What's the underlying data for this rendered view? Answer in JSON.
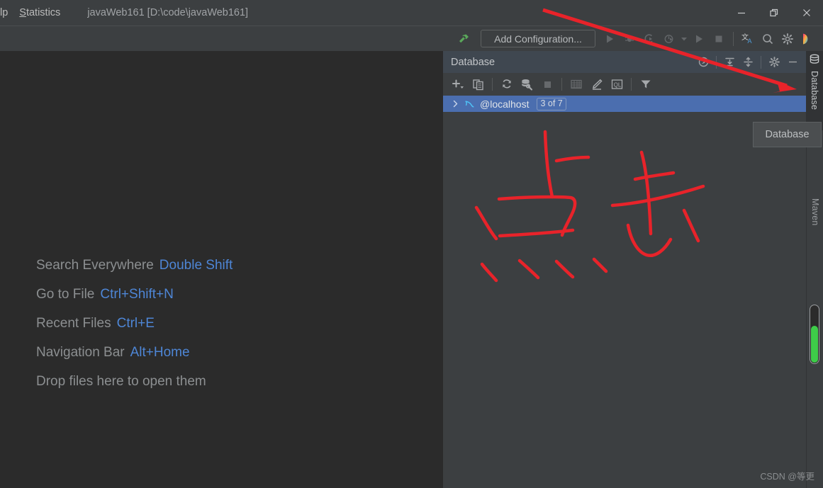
{
  "window": {
    "menu_items": [
      {
        "id": "help",
        "label": "lp",
        "clipped": true
      },
      {
        "id": "statistics",
        "label_prefix": "S",
        "label_rest": "tatistics"
      }
    ],
    "project_title": "javaWeb161 [D:\\code\\javaWeb161]",
    "controls": {
      "minimize": "minimize-button",
      "restore": "restore-button",
      "close": "close-button"
    }
  },
  "toolbar": {
    "build_icon": "hammer-icon",
    "configuration_label": "Add Configuration...",
    "run_icon": "run-icon",
    "debug_icon": "debug-icon",
    "coverage_icon": "run-with-coverage-icon",
    "profiler_icon": "profiler-icon",
    "profiler_dropdown_icon": "chevron-down-icon",
    "run_secondary_icon": "run-icon",
    "stop_icon": "stop-icon",
    "translate_icon": "translate-icon",
    "search_icon": "search-icon",
    "settings_icon": "gear-icon",
    "ide_logo_icon": "idea-logo-icon"
  },
  "editor": {
    "hints": [
      {
        "label": "Search Everywhere",
        "key": "Double Shift"
      },
      {
        "label": "Go to File",
        "key": "Ctrl+Shift+N"
      },
      {
        "label": "Recent Files",
        "key": "Ctrl+E"
      },
      {
        "label": "Navigation Bar",
        "key": "Alt+Home"
      },
      {
        "label": "Drop files here to open them",
        "key": ""
      }
    ]
  },
  "database_panel": {
    "title": "Database",
    "header_actions": [
      {
        "name": "scroll-from-source-icon",
        "label": "Scroll from Source"
      },
      {
        "name": "expand-all-icon",
        "label": "Expand All"
      },
      {
        "name": "collapse-all-icon",
        "label": "Collapse All"
      },
      {
        "name": "gear-icon",
        "label": "Options"
      },
      {
        "name": "hide-icon",
        "label": "Hide"
      }
    ],
    "toolbar_actions": [
      {
        "name": "add-new-icon",
        "label": "New",
        "disabled": false
      },
      {
        "name": "duplicate-icon",
        "label": "Duplicate",
        "disabled": false
      },
      {
        "name": "refresh-icon",
        "label": "Refresh",
        "disabled": false
      },
      {
        "name": "data-source-properties-icon",
        "label": "Data Source Properties",
        "disabled": false
      },
      {
        "name": "stop-icon",
        "label": "Stop",
        "disabled": true
      },
      {
        "name": "table-editor-icon",
        "label": "Table Editor",
        "disabled": false
      },
      {
        "name": "modify-icon",
        "label": "Modify",
        "disabled": false
      },
      {
        "name": "query-console-icon",
        "label": "QL",
        "disabled": false
      },
      {
        "name": "filter-icon",
        "label": "Filter",
        "disabled": false
      }
    ],
    "tree": [
      {
        "expander": "chevron-right-icon",
        "icon": "mysql-dolphin-icon",
        "label": "@localhost",
        "badge": "3 of 7",
        "selected": true
      }
    ],
    "tooltip": "Database"
  },
  "right_stripe": {
    "top_icon": "database-cylinder-icon",
    "tabs": [
      {
        "label": "Database",
        "active": true
      },
      {
        "label": "Maven",
        "active": false
      }
    ],
    "memory_indicator": {
      "name": "memory-indicator",
      "fill_color": "#3ecc49"
    }
  },
  "annotations": {
    "arrow": {
      "name": "red-arrow-annotation",
      "color": "#e8232a"
    },
    "handwriting": {
      "name": "red-handwriting-annotation",
      "color": "#e8232a"
    }
  },
  "watermark": "CSDN @等更",
  "colors": {
    "titlebar": "#3c3f41",
    "editor_bg": "#2b2b2b",
    "panel_bg": "#3c3f41",
    "panel_header": "#3f4750",
    "selection": "#4b6eaf",
    "hint_key": "#4e86d6",
    "annotation_red": "#e8232a"
  }
}
